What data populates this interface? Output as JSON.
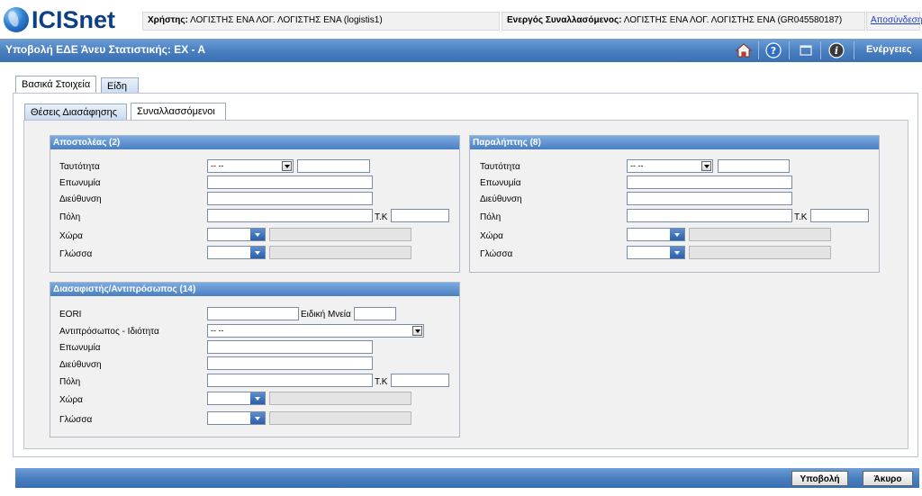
{
  "header": {
    "logo_text": "ICISnet",
    "user_label": "Χρήστης:",
    "user_value": "ΛΟΓΙΣΤΗΣ ΕΝΑ ΛΟΓ. ΛΟΓΙΣΤΗΣ ΕΝΑ (logistis1)",
    "trader_label": "Ενεργός Συναλλασόμενος:",
    "trader_value": "ΛΟΓΙΣΤΗΣ ΕΝΑ ΛΟΓ. ΛΟΓΙΣΤΗΣ ΕΝΑ (GR045580187)",
    "logout": "Αποσύνδεση"
  },
  "titlebar": {
    "title": "Υποβολή ΕΔΕ Άνευ Στατιστικής: EX - A",
    "actions": "Ενέργειες",
    "icons": [
      "home-icon",
      "help-icon",
      "window-icon",
      "info-icon"
    ]
  },
  "tabs": {
    "outer": [
      {
        "label": "Βασικά Στοιχεία",
        "active": true
      },
      {
        "label": "Είδη",
        "active": false
      }
    ],
    "inner": [
      {
        "label": "Θέσεις Διασάφησης",
        "active": false
      },
      {
        "label": "Συναλλασσόμενοι",
        "active": true
      }
    ]
  },
  "consignor": {
    "title": "Αποστολέας (2)",
    "labels": {
      "identity": "Ταυτότητα",
      "name": "Επωνυμία",
      "address": "Διεύθυνση",
      "city": "Πόλη",
      "postcode": "Τ.Κ",
      "country": "Χώρα",
      "language": "Γλώσσα"
    },
    "identity_select": "-- --"
  },
  "consignee": {
    "title": "Παραλήπτης (8)",
    "labels": {
      "identity": "Ταυτότητα",
      "name": "Επωνυμία",
      "address": "Διεύθυνση",
      "city": "Πόλη",
      "postcode": "Τ.Κ",
      "country": "Χώρα",
      "language": "Γλώσσα"
    },
    "identity_select": "-- --"
  },
  "declarant": {
    "title": "Διασαφιστής/Αντιπρόσωπος (14)",
    "labels": {
      "eori": "EORI",
      "special_mention": "Ειδική Μνεία",
      "rep_status": "Αντιπρόσωπος - Ιδιότητα",
      "name": "Επωνυμία",
      "address": "Διεύθυνση",
      "city": "Πόλη",
      "postcode": "Τ.Κ",
      "country": "Χώρα",
      "language": "Γλώσσα"
    },
    "rep_select": "-- --"
  },
  "footer": {
    "submit": "Υποβολή",
    "cancel": "Άκυρο"
  }
}
